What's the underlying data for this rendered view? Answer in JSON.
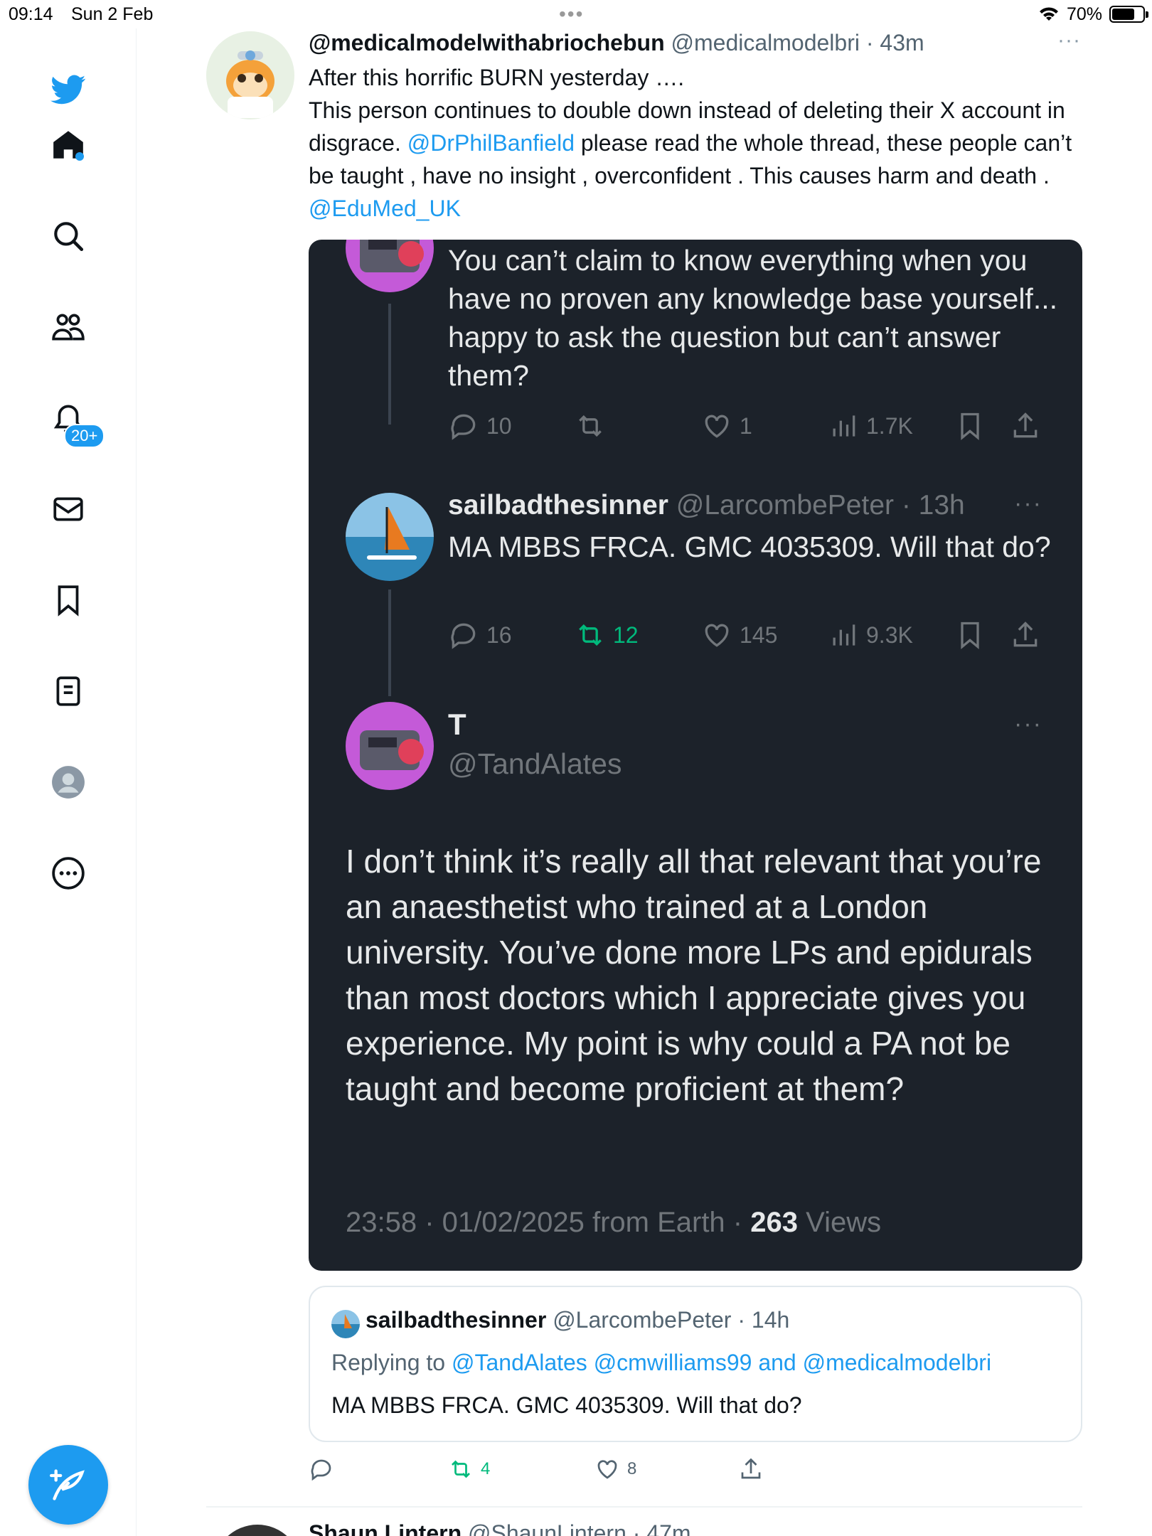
{
  "status_bar": {
    "time": "09:14",
    "date": "Sun 2 Feb",
    "battery": "70%"
  },
  "sidebar": {
    "notifications_badge": "20+",
    "items": [
      "twitter-logo",
      "home",
      "explore",
      "communities",
      "notifications",
      "messages",
      "bookmarks",
      "lists",
      "profile",
      "more"
    ]
  },
  "tweet": {
    "name": "@medicalmodelwithabriochebun",
    "handle": "@medicalmodelbri",
    "time": "· 43m",
    "more": "···",
    "body_1": "After this horrific BURN yesterday ….",
    "body_2": "This person continues to double down instead of deleting their X account in disgrace.",
    "mention_1": "@DrPhilBanfield",
    "body_3": "please read the whole thread, these people can’t be taught , have no insight , overconfident . This causes harm and  death .",
    "mention_2": "@EduMed_UK"
  },
  "embed": {
    "post1": {
      "text": "You can’t claim to know everything when you have no proven any knowledge base yourself... happy to ask the question but can’t answer them?",
      "replies": "10",
      "retweets": "",
      "likes": "1",
      "views": "1.7K"
    },
    "post2": {
      "name": "sailbadthesinner",
      "handle": "@LarcombePeter · 13h",
      "more": "···",
      "text": "MA MBBS FRCA. GMC 4035309. Will that do?",
      "replies": "16",
      "retweets": "12",
      "likes": "145",
      "views": "9.3K"
    },
    "post3": {
      "name": "T",
      "handle": "@TandAlates",
      "more": "···",
      "text": "I don’t think it’s really all that relevant that you’re an anaesthetist who trained at a London university. You’ve done more LPs and epidurals than most doctors which I appreciate gives you experience. My point is why could a PA not be taught and become proficient at them?",
      "footer_time": "23:58 · 01/02/2025 from Earth ·",
      "footer_views_count": "263",
      "footer_views_label": "Views"
    }
  },
  "quote": {
    "name": "sailbadthesinner",
    "handle": "@LarcombePeter · 14h",
    "replying_prefix": "Replying to",
    "replying_users": "@TandAlates @cmwilliams99",
    "replying_and": "and",
    "replying_last": "@medicalmodelbri",
    "text": "MA MBBS FRCA. GMC 4035309. Will that do?"
  },
  "tweet_actions": {
    "replies": "",
    "retweets": "4",
    "likes": "8"
  },
  "next_tweet": {
    "name": "Shaun Lintern",
    "handle": "@ShaunLintern · 47m"
  },
  "colors": {
    "accent": "#1d9bf0",
    "embed_bg": "#1c222a",
    "retweet_green": "#00ba7c"
  }
}
